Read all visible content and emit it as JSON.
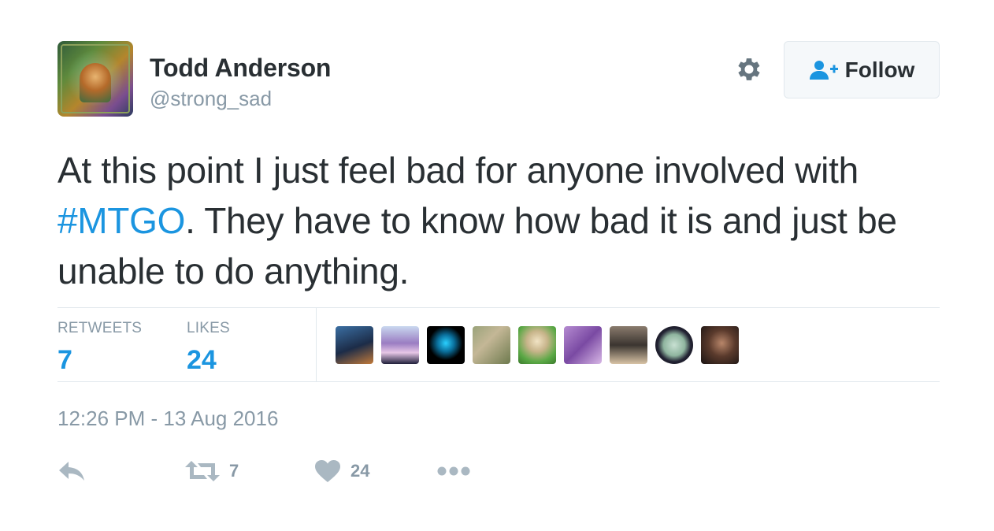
{
  "user": {
    "name": "Todd Anderson",
    "handle": "@strong_sad"
  },
  "follow_button": {
    "label": "Follow"
  },
  "tweet": {
    "text_before": "At this point I just feel bad for anyone involved with ",
    "hashtag": "#MTGO",
    "text_after": ". They have to know how bad it is and just be unable to do anything.",
    "timestamp": "12:26 PM - 13 Aug 2016"
  },
  "stats": {
    "retweets_label": "RETWEETS",
    "retweets_value": "7",
    "likes_label": "LIKES",
    "likes_value": "24"
  },
  "likers": [
    {
      "name": "liker-1"
    },
    {
      "name": "liker-2"
    },
    {
      "name": "liker-3"
    },
    {
      "name": "liker-4"
    },
    {
      "name": "liker-5"
    },
    {
      "name": "liker-6"
    },
    {
      "name": "liker-7"
    },
    {
      "name": "liker-8"
    },
    {
      "name": "liker-9"
    }
  ],
  "actions": {
    "retweet_count": "7",
    "like_count": "24"
  },
  "colors": {
    "accent": "#1b95e0",
    "text": "#292f33",
    "muted": "#8899a6",
    "icon": "#aab8c2"
  },
  "icons": {
    "settings": "gear-icon",
    "follow": "add-user-icon",
    "reply": "reply-icon",
    "retweet": "retweet-icon",
    "like": "heart-icon",
    "more": "more-icon"
  }
}
